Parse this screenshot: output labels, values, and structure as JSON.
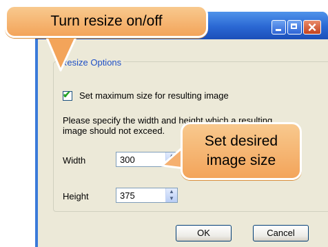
{
  "dialog": {
    "group_title": "Resize Options",
    "checkbox_label": "Set maximum size for resulting image",
    "checkbox_checked": true,
    "description_line1": "Please specify the width and height which a resulting",
    "description_line2": "image should not exceed.",
    "width_label": "Width",
    "width_value": "300",
    "height_label": "Height",
    "height_value": "375",
    "ok_label": "OK",
    "cancel_label": "Cancel"
  },
  "callouts": {
    "resize_toggle": "Turn resize on/off",
    "size_line1": "Set desired",
    "size_line2": "image size"
  },
  "titlebar_icons": [
    "minimize-icon",
    "maximize-icon",
    "close-icon"
  ],
  "colors": {
    "callout_fill": "#f5b36c",
    "dialog_background": "#ece9d8",
    "titlebar_blue": "#2a67d3",
    "group_title_blue": "#1e4fc6",
    "check_green": "#21a121"
  }
}
